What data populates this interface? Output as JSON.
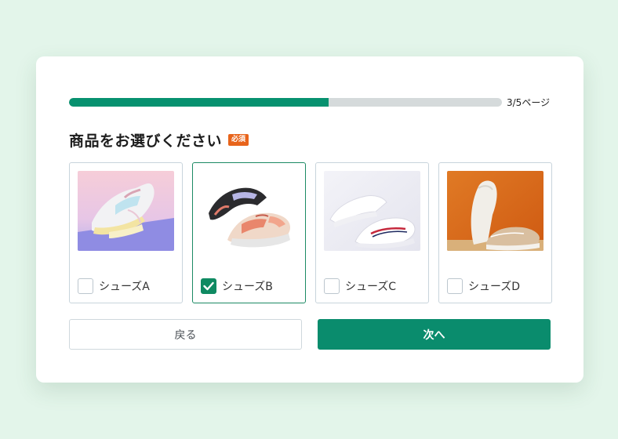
{
  "progress": {
    "label": "3/5ページ",
    "fraction": 0.6
  },
  "question": {
    "title": "商品をお選びください",
    "required_badge": "必須"
  },
  "options": [
    {
      "label": "シューズA",
      "checked": false
    },
    {
      "label": "シューズB",
      "checked": true
    },
    {
      "label": "シューズC",
      "checked": false
    },
    {
      "label": "シューズD",
      "checked": false
    }
  ],
  "buttons": {
    "back": "戻る",
    "next": "次へ"
  },
  "colors": {
    "accent": "#0a8c6d",
    "required": "#e8641b",
    "background": "#e3f5ea"
  }
}
